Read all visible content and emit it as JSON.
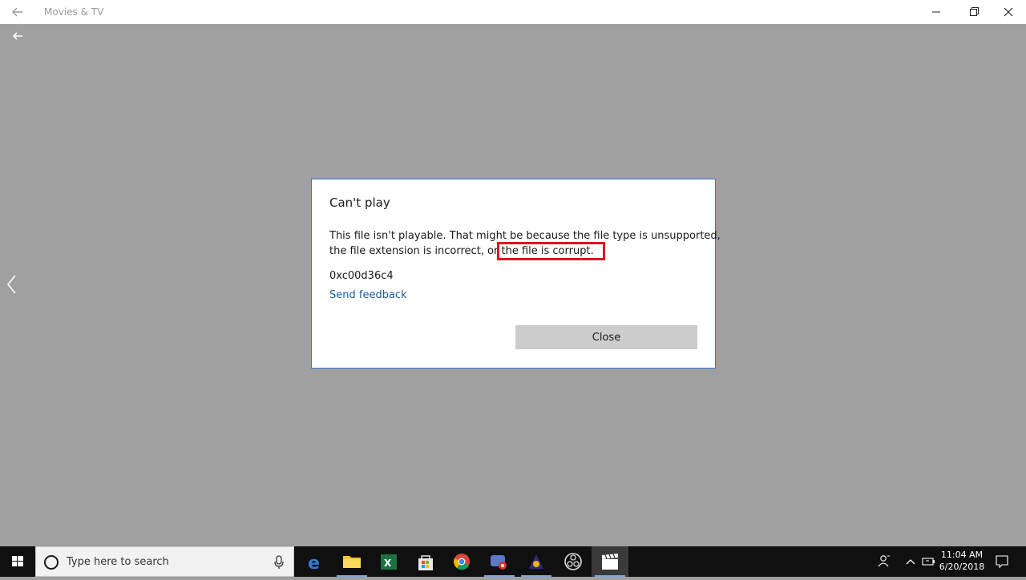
{
  "window": {
    "title": "Movies & TV"
  },
  "dialog": {
    "title": "Can't play",
    "message_line1": "This file isn't playable. That might be because the file type is unsupported,",
    "message_line2_pre": "the file extension is incorrect, or",
    "message_line2_highlight": "the file is corrupt.",
    "error_code": "0xc00d36c4",
    "feedback_link": "Send feedback",
    "close_button": "Close"
  },
  "taskbar": {
    "search_placeholder": "Type here to search",
    "apps": [
      "edge-icon",
      "file-explorer-icon",
      "excel-icon",
      "store-icon",
      "chrome-icon",
      "screen-recorder-icon",
      "media-app-icon",
      "obs-icon",
      "movies-tv-icon"
    ],
    "clock_time": "11:04 AM",
    "clock_date": "6/20/2018"
  },
  "colors": {
    "highlight_box": "#e0141e",
    "dialog_border": "#2b79d0",
    "link": "#1a5e9e"
  }
}
